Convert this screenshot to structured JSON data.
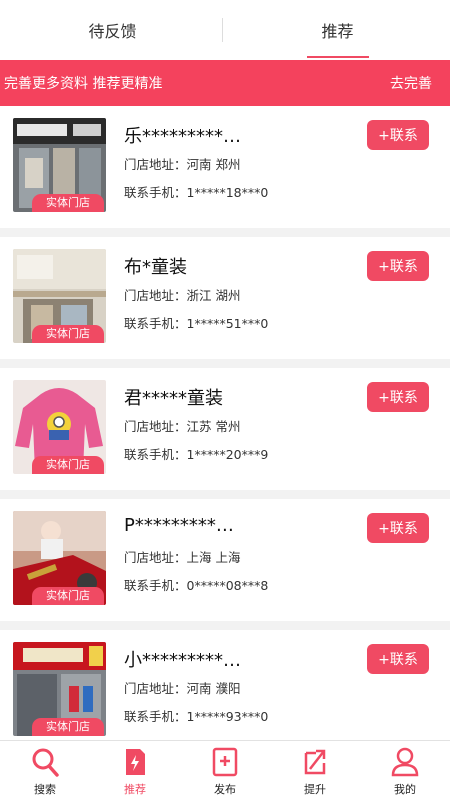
{
  "tabs": [
    {
      "label": "待反馈",
      "active": false
    },
    {
      "label": "推荐",
      "active": true
    }
  ],
  "banner": {
    "text": "完善更多资料 推荐更精准",
    "link": "去完善"
  },
  "cards": [
    {
      "name": "乐*********…",
      "addr_label": "门店地址：",
      "addr": "河南 郑州",
      "phone_label": "联系手机：",
      "phone": "1*****18***0",
      "badge": "实体门店",
      "contact": "+联系",
      "thumb": "storefront-photo"
    },
    {
      "name": "布*童装",
      "addr_label": "门店地址：",
      "addr": "浙江 湖州",
      "phone_label": "联系手机：",
      "phone": "1*****51***0",
      "badge": "实体门店",
      "contact": "+联系",
      "thumb": "storefront-photo"
    },
    {
      "name": "君*****童装",
      "addr_label": "门店地址：",
      "addr": "江苏 常州",
      "phone_label": "联系手机：",
      "phone": "1*****20***9",
      "badge": "实体门店",
      "contact": "+联系",
      "thumb": "pink-hoodie-photo"
    },
    {
      "name": "P*********…",
      "addr_label": "门店地址：",
      "addr": "上海 上海",
      "phone_label": "联系手机：",
      "phone": "0*****08***8",
      "badge": "实体门店",
      "contact": "+联系",
      "thumb": "doll-display-photo"
    },
    {
      "name": "小*********…",
      "addr_label": "门店地址：",
      "addr": "河南 濮阳",
      "phone_label": "联系手机：",
      "phone": "1*****93***0",
      "badge": "实体门店",
      "contact": "+联系",
      "thumb": "storefront-photo"
    }
  ],
  "nav": [
    {
      "label": "搜索",
      "icon": "search-icon",
      "active": false
    },
    {
      "label": "推荐",
      "icon": "recommend-icon",
      "active": true
    },
    {
      "label": "发布",
      "icon": "publish-icon",
      "active": false
    },
    {
      "label": "提升",
      "icon": "boost-icon",
      "active": false
    },
    {
      "label": "我的",
      "icon": "profile-icon",
      "active": false
    }
  ],
  "colors": {
    "accent": "#f04a63",
    "banner": "#f4425d",
    "background": "#f2f2f2"
  }
}
